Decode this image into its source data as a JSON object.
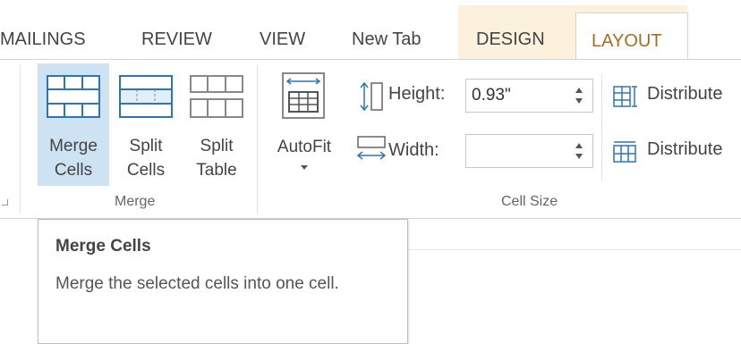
{
  "tabs": {
    "mailings": "MAILINGS",
    "review": "REVIEW",
    "view": "VIEW",
    "newtab": "New Tab",
    "design": "DESIGN",
    "layout": "LAYOUT"
  },
  "merge_group": {
    "label": "Merge",
    "merge_cells": [
      "Merge",
      "Cells"
    ],
    "split_cells": [
      "Split",
      "Cells"
    ],
    "split_table": [
      "Split",
      "Table"
    ]
  },
  "autofit": {
    "label": "AutoFit"
  },
  "cell_size": {
    "label": "Cell Size",
    "height_label": "Height:",
    "height_value": "0.93\"",
    "width_label": "Width:",
    "width_value": "",
    "distribute_rows": "Distribute",
    "distribute_cols": "Distribute"
  },
  "tooltip": {
    "title": "Merge Cells",
    "body": "Merge the selected cells into one cell."
  },
  "colors": {
    "accent_tab": "#a76d1e",
    "design_tab_bg": "#fbf1dc",
    "selected_btn": "#cde2f3",
    "icon_blue": "#2e75b6"
  }
}
